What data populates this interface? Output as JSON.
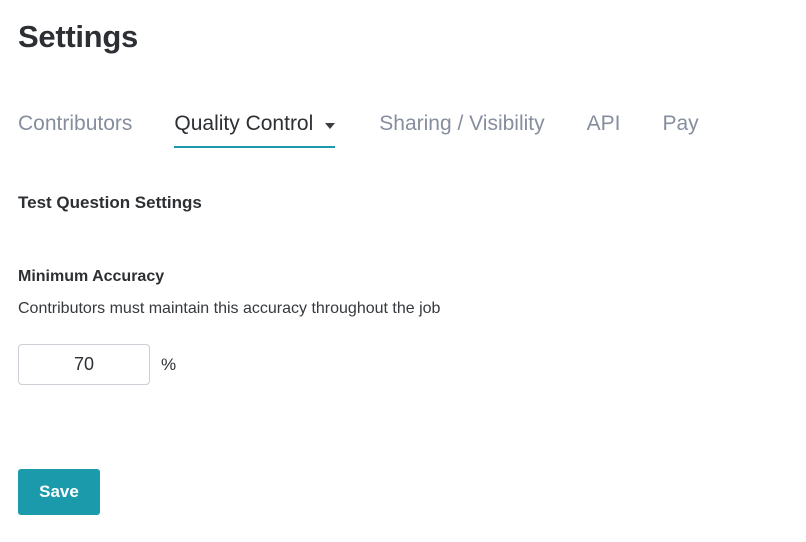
{
  "page": {
    "title": "Settings"
  },
  "tabs": {
    "items": [
      {
        "label": "Contributors",
        "active": false,
        "has_caret": false
      },
      {
        "label": "Quality Control",
        "active": true,
        "has_caret": true
      },
      {
        "label": "Sharing / Visibility",
        "active": false,
        "has_caret": false
      },
      {
        "label": "API",
        "active": false,
        "has_caret": false
      },
      {
        "label": "Pay",
        "active": false,
        "has_caret": false
      }
    ],
    "active_underline_color": "#1a9aab",
    "inactive_color": "#868e9e",
    "active_color": "#2c2f33"
  },
  "section": {
    "title": "Test Question Settings"
  },
  "minimum_accuracy": {
    "label": "Minimum Accuracy",
    "help_text": "Contributors must maintain this accuracy throughout the job",
    "value": "70",
    "placeholder": "",
    "unit": "%"
  },
  "actions": {
    "save_label": "Save",
    "save_color": "#1a9aab"
  }
}
